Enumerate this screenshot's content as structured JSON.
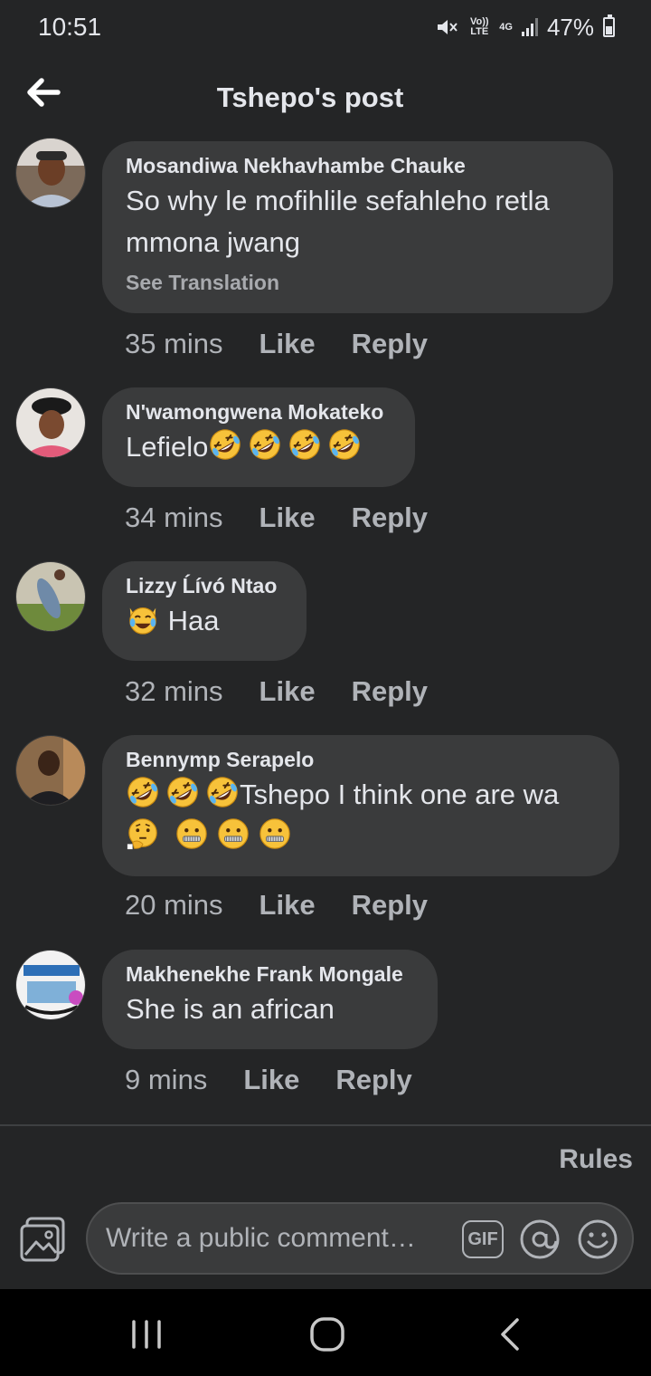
{
  "status_bar": {
    "time": "10:51",
    "volte_label": "Vo)) LTE",
    "network_label": "4G",
    "battery": "47%"
  },
  "header": {
    "title": "Tshepo's post"
  },
  "comments": [
    {
      "author": "Mosandiwa Nekhavhambe Chauke",
      "text_lines": [
        "So why le mofihlile sefahleho retla",
        "mmona jwang"
      ],
      "see_translation": "See Translation",
      "time": "35 mins",
      "like": "Like",
      "reply": "Reply"
    },
    {
      "author": "N'wamongwena Mokateko",
      "text": "Lefielo",
      "emojis": [
        "rolling-on-floor-laughing",
        "rolling-on-floor-laughing",
        "rolling-on-floor-laughing",
        "rolling-on-floor-laughing"
      ],
      "time": "34 mins",
      "like": "Like",
      "reply": "Reply"
    },
    {
      "author": "Lizzy Ĺívó Ntao",
      "text": "Haa",
      "emojis": [
        "cat-tears-of-joy"
      ],
      "time": "32 mins",
      "like": "Like",
      "reply": "Reply"
    },
    {
      "author": "Bennymp Serapelo",
      "text": "Tshepo I think one are wa",
      "emojis_line1": [
        "rolling-on-floor-laughing",
        "rolling-on-floor-laughing",
        "rolling-on-floor-laughing"
      ],
      "emojis_line2": [
        "thinking-face",
        "zipper-mouth-face",
        "zipper-mouth-face",
        "zipper-mouth-face"
      ],
      "time": "20 mins",
      "like": "Like",
      "reply": "Reply"
    },
    {
      "author": "Makhenekhe Frank Mongale",
      "text": "She is an african",
      "time": "9 mins",
      "like": "Like",
      "reply": "Reply"
    }
  ],
  "footer": {
    "rules": "Rules",
    "comment_placeholder": "Write a public comment…",
    "gif_label": "GIF"
  },
  "colors": {
    "background": "#242526",
    "bubble": "#3a3b3c",
    "text_primary": "#e4e6eb",
    "text_secondary": "#b0b3b8"
  }
}
